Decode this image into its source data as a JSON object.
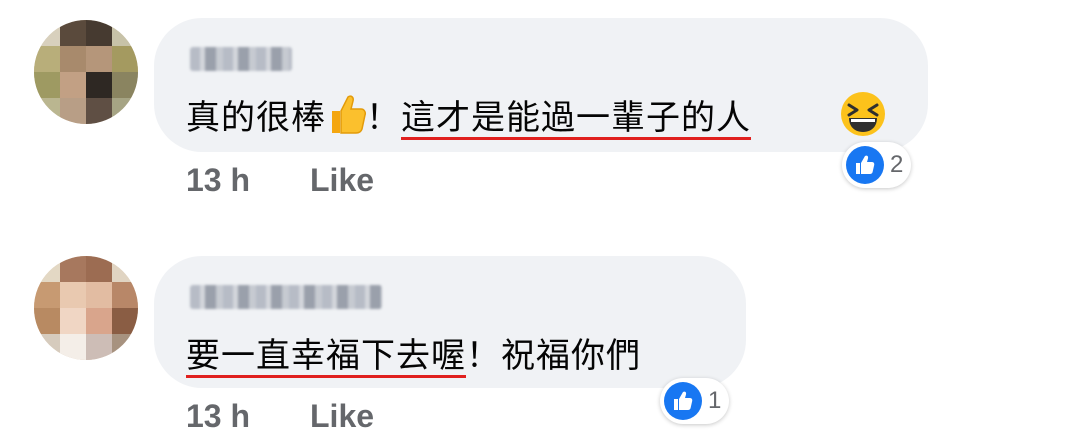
{
  "comments": [
    {
      "text_plain": "真的很棒",
      "emoji_thumb": "thumbs-up-emoji",
      "punct": "！",
      "text_highlight": "這才是能過一輩子的人",
      "emoji_end": "grinning-squinting-face-emoji",
      "time": "13 h",
      "like_label": "Like",
      "reaction_icon": "like-thumb-icon",
      "reaction_count": "2"
    },
    {
      "text_highlight": "要一直幸福下去喔",
      "text_plain": "！祝福你們",
      "time": "13 h",
      "like_label": "Like",
      "reaction_icon": "like-thumb-icon",
      "reaction_count": "1"
    }
  ],
  "colors": {
    "bubble": "#f0f2f5",
    "like_blue": "#1877f2",
    "underline_red": "#e0201e",
    "meta_gray": "#65676b"
  }
}
